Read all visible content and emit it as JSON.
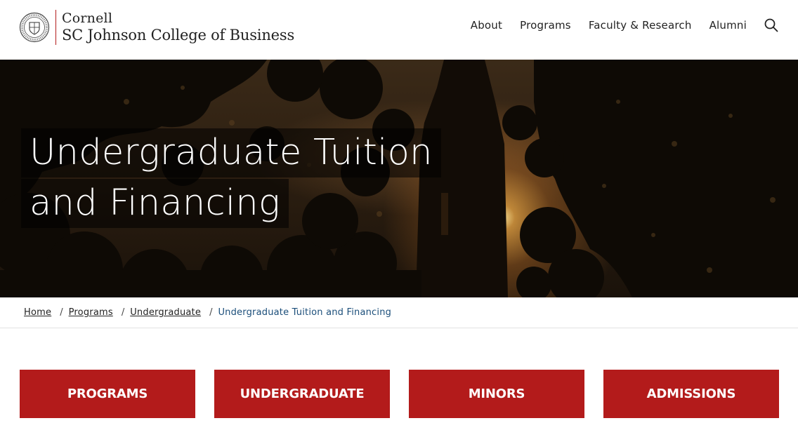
{
  "header": {
    "logo_line1": "Cornell",
    "logo_line2": "SC Johnson College of Business",
    "seal_icon": "cornell-seal-icon",
    "nav": [
      {
        "label": "About"
      },
      {
        "label": "Programs"
      },
      {
        "label": "Faculty & Research"
      },
      {
        "label": "Alumni"
      }
    ],
    "search_icon": "search-icon"
  },
  "hero": {
    "title_line1": "Undergraduate Tuition",
    "title_line2": "and Financing"
  },
  "breadcrumb": {
    "items": [
      {
        "label": "Home"
      },
      {
        "label": "Programs"
      },
      {
        "label": "Undergraduate"
      }
    ],
    "current": "Undergraduate Tuition and Financing"
  },
  "buttons": [
    {
      "label": "PROGRAMS"
    },
    {
      "label": "UNDERGRADUATE"
    },
    {
      "label": "MINORS"
    },
    {
      "label": "ADMISSIONS"
    }
  ],
  "colors": {
    "brand_red": "#b31b1b",
    "breadcrumb_current": "#1b4e7a"
  }
}
